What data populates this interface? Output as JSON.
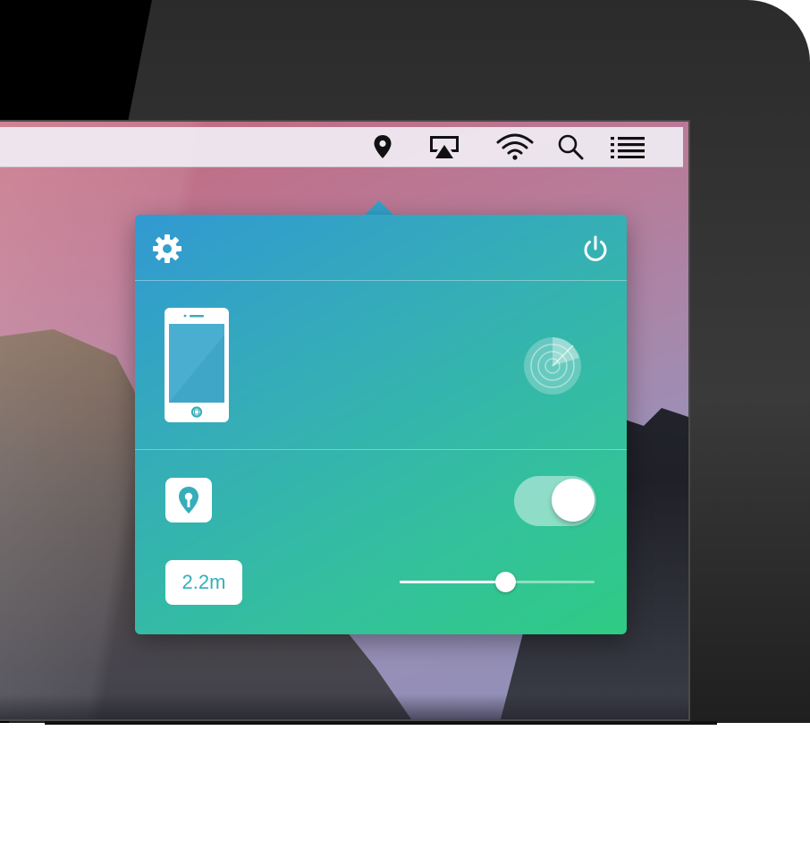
{
  "menubar": {
    "icons": [
      "location-pin-icon",
      "airplay-icon",
      "wifi-icon",
      "search-icon",
      "list-icon"
    ]
  },
  "popover": {
    "header": {
      "settings_icon": "gear-icon",
      "power_icon": "power-icon"
    },
    "device": {
      "device_icon": "iphone-icon",
      "scan_icon": "radar-icon"
    },
    "location": {
      "pin_icon": "location-pin-icon",
      "toggle_on": true
    },
    "range": {
      "distance_label": "2.2m",
      "slider_fraction": 0.54
    }
  },
  "colors": {
    "popover_gradient_start": "#3199d2",
    "popover_gradient_end": "#2fcb84",
    "accent_text": "#35aeba",
    "menubar": "#eee8f0"
  }
}
